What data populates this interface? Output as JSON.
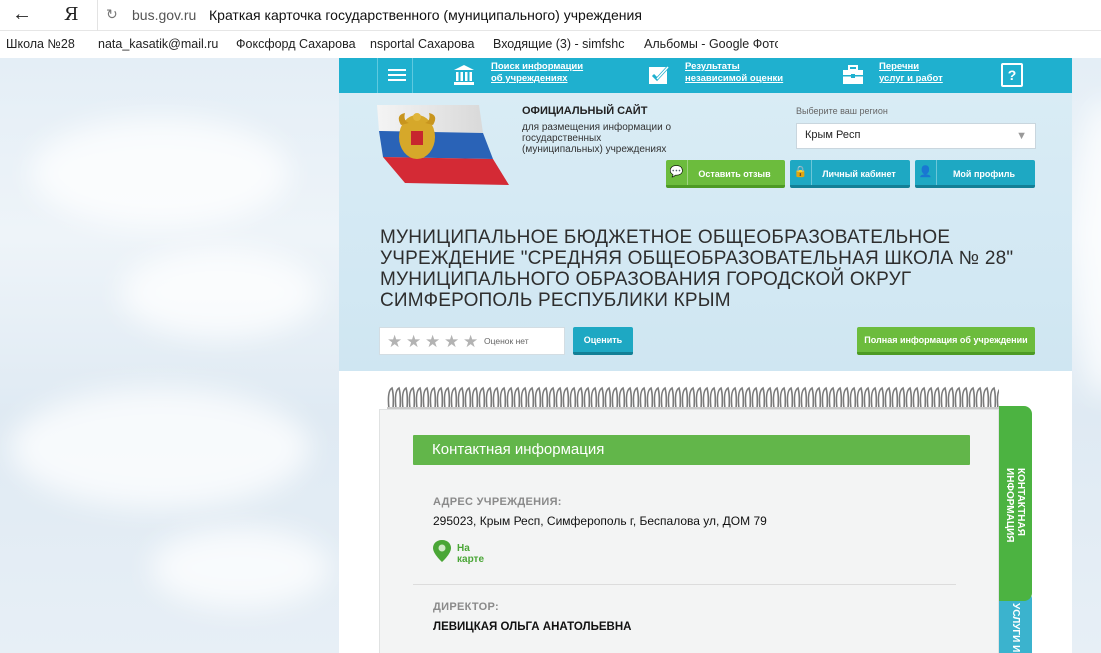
{
  "browser": {
    "url": "bus.gov.ru",
    "page_title": "Краткая карточка государственного (муниципального) учреждения",
    "bookmarks": [
      "Школа №28",
      "nata_kasatik@mail.ru",
      "Фоксфорд Сахарова",
      "nsportal Сахарова",
      "Входящие (3) - simfshc",
      "Альбомы - Google Фото"
    ]
  },
  "topnav": {
    "items": [
      {
        "label_line1": "Поиск информации",
        "label_line2": "об учреждениях",
        "icon": "building-icon"
      },
      {
        "label_line1": "Результаты",
        "label_line2": "независимой оценки",
        "icon": "checkbox-icon"
      },
      {
        "label_line1": "Перечни",
        "label_line2": "услуг и работ",
        "icon": "briefcase-icon"
      }
    ],
    "help_label": "?"
  },
  "header": {
    "site_name": "ОФИЦИАЛЬНЫЙ САЙТ",
    "site_desc": "для размещения информации о государственных (муниципальных) учреждениях",
    "region_label": "Выберите ваш регион",
    "region_value": "Крым Респ",
    "buttons": {
      "feedback": "Оставить отзыв",
      "cabinet": "Личный кабинет",
      "profile": "Мой профиль"
    },
    "org_title": "МУНИЦИПАЛЬНОЕ БЮДЖЕТНОЕ ОБЩЕОБРАЗОВАТЕЛЬНОЕ УЧРЕЖДЕНИЕ \"СРЕДНЯЯ ОБЩЕОБРАЗОВАТЕЛЬНАЯ ШКОЛА № 28\" МУНИЦИПАЛЬНОГО ОБРАЗОВАНИЯ ГОРОДСКОЙ ОКРУГ СИМФЕРОПОЛЬ РЕСПУБЛИКИ КРЫМ",
    "rating_text": "Оценок нет",
    "rating_value": 0,
    "rating_max": 5,
    "rate_button": "Оценить",
    "full_info_button": "Полная информация об учреждении"
  },
  "card": {
    "title": "Контактная информация",
    "address_label": "АДРЕС УЧРЕЖДЕНИЯ:",
    "address_value": "295023, Крым Респ, Симферополь г, Беспалова ул, ДОМ 79",
    "map_line1": "На",
    "map_line2": "карте",
    "director_label": "ДИРЕКТОР:",
    "director_value": "ЛЕВИЦКАЯ ОЛЬГА АНАТОЛЬЕВНА"
  },
  "side_tabs": {
    "contact": "КОНТАКТНАЯ ИНФОРМАЦИЯ",
    "services": "УСЛУГИ И"
  },
  "colors": {
    "nav_blue": "#1fb0cf",
    "green": "#6cbc3d",
    "card_green": "#62b64a"
  }
}
